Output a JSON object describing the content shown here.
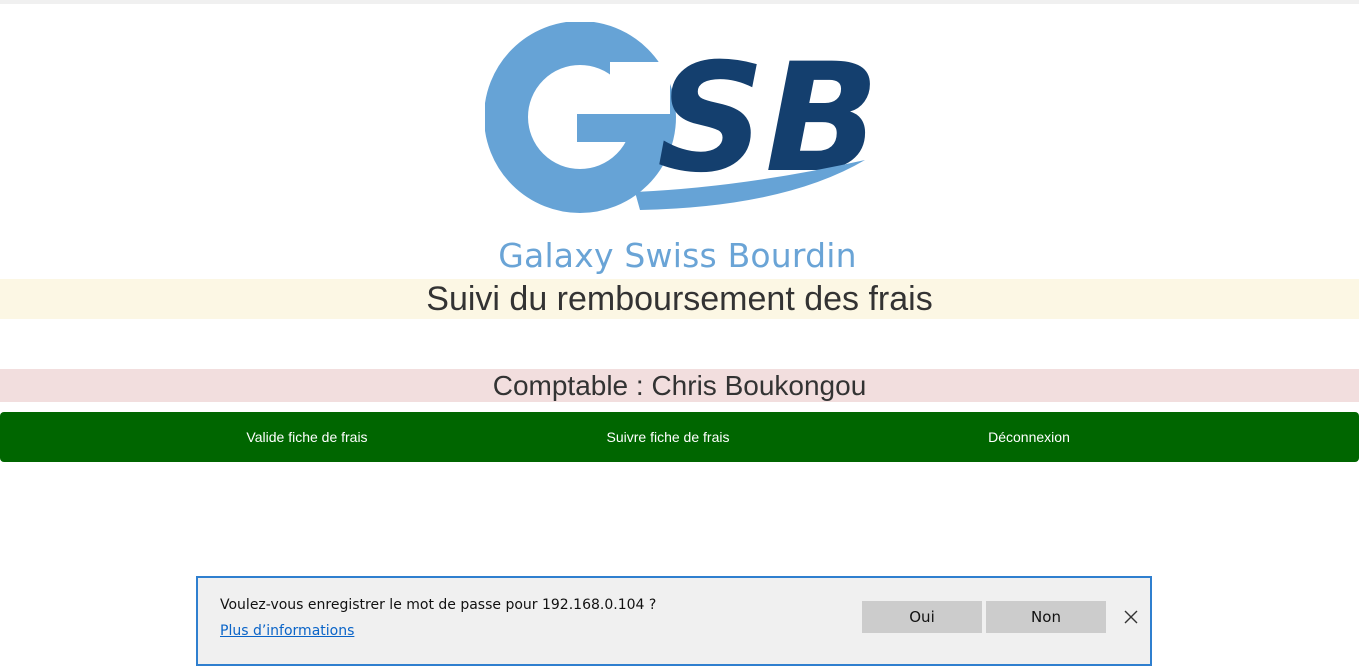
{
  "logo": {
    "letters": "GSB",
    "tagline": "Galaxy Swiss Bourdin",
    "colors": {
      "light_blue": "#66a3d6",
      "dark_blue": "#143f6e"
    }
  },
  "header": {
    "title": "Suivi du remboursement des frais",
    "user_label": "Comptable : Chris Boukongou"
  },
  "nav": {
    "color": "#006600",
    "items": [
      {
        "label": "Valide fiche de frais"
      },
      {
        "label": "Suivre fiche de frais"
      },
      {
        "label": "Déconnexion"
      }
    ]
  },
  "password_prompt": {
    "message": "Voulez-vous enregistrer le mot de passe pour 192.168.0.104 ?",
    "link": "Plus d’informations",
    "yes_label": "Oui",
    "no_label": "Non",
    "close_icon": "close-icon"
  }
}
